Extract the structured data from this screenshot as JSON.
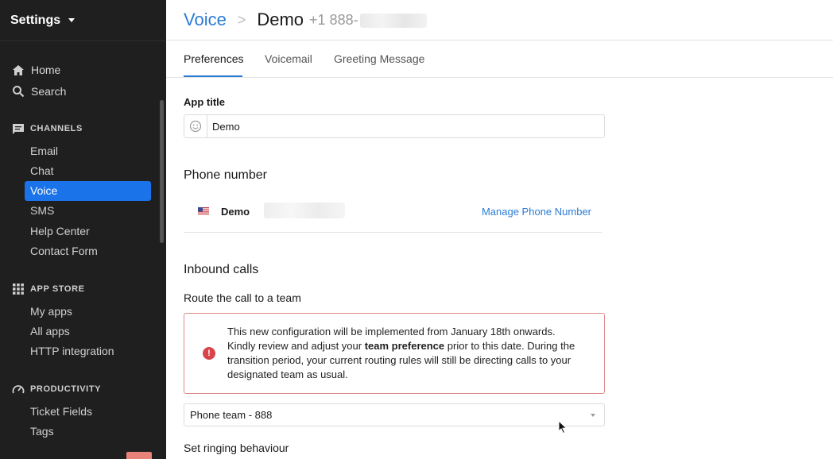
{
  "sidebar": {
    "title": "Settings",
    "home": "Home",
    "search": "Search",
    "channels_header": "CHANNELS",
    "channels": [
      "Email",
      "Chat",
      "Voice",
      "SMS",
      "Help Center",
      "Contact Form"
    ],
    "active_item": "Voice",
    "appstore_header": "APP STORE",
    "appstore": [
      "My apps",
      "All apps",
      "HTTP integration"
    ],
    "productivity_header": "PRODUCTIVITY",
    "productivity": [
      "Ticket Fields",
      "Tags"
    ]
  },
  "header": {
    "breadcrumb_root": "Voice",
    "separator": ">",
    "app_name": "Demo",
    "phone_prefix": "+1 888-"
  },
  "tabs": [
    {
      "label": "Preferences",
      "active": true
    },
    {
      "label": "Voicemail",
      "active": false
    },
    {
      "label": "Greeting Message",
      "active": false
    }
  ],
  "form": {
    "app_title_label": "App title",
    "app_title_value": "Demo",
    "phone_number_heading": "Phone number",
    "phone_name": "Demo",
    "manage_phone_link": "Manage Phone Number",
    "inbound_heading": "Inbound calls",
    "route_label": "Route the call to a team",
    "alert_text_1": "This new configuration will be implemented from January 18th onwards. Kindly review and adjust your ",
    "alert_bold": "team preference",
    "alert_text_2": " prior to this date. During the transition period, your current routing rules will still be directing calls to your designated team as usual.",
    "team_select_value": "Phone team - 888",
    "ringing_label": "Set ringing behaviour"
  },
  "colors": {
    "accent": "#2b7bd6",
    "sidebar_bg": "#1f1f1f",
    "active_bg": "#1a73e8",
    "alert_border": "#e08a8a",
    "alert_icon": "#d9444c"
  }
}
